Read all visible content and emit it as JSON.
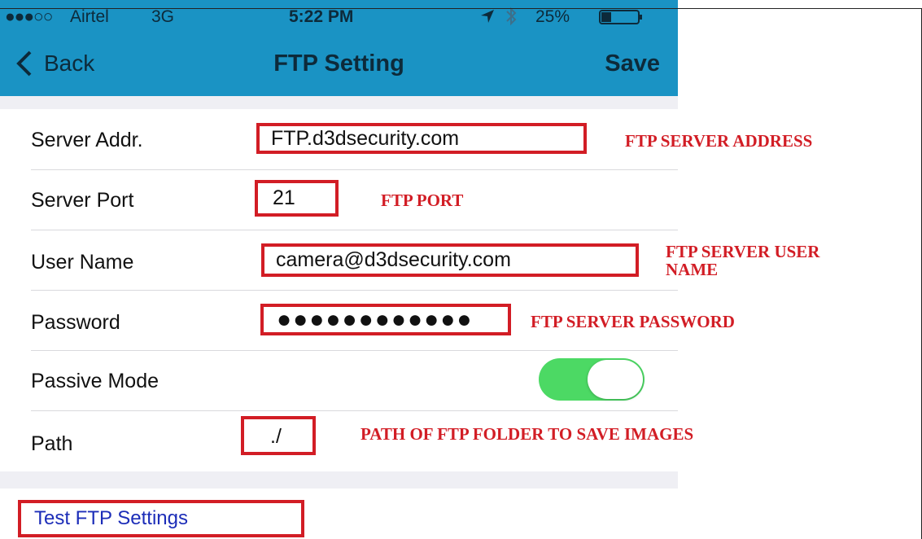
{
  "status_bar": {
    "signal": "●●●○○",
    "carrier": "Airtel",
    "network": "3G",
    "time": "5:22 PM",
    "battery": "25%"
  },
  "nav": {
    "back_label": "Back",
    "title": "FTP Setting",
    "save_label": "Save"
  },
  "form": {
    "server_addr": {
      "label": "Server Addr.",
      "value": "FTP.d3dsecurity.com"
    },
    "server_port": {
      "label": "Server Port",
      "value": "21"
    },
    "user_name": {
      "label": "User Name",
      "value": "camera@d3dsecurity.com"
    },
    "password": {
      "label": "Password",
      "value": "●●●●●●●●●●●●"
    },
    "passive_mode": {
      "label": "Passive Mode",
      "on": true
    },
    "path": {
      "label": "Path",
      "value": "./"
    }
  },
  "test_button": {
    "label": "Test FTP Settings"
  },
  "annotations": {
    "server_address": "FTP SERVER ADDRESS",
    "port": "FTP PORT",
    "user_name_line1": "FTP SERVER USER",
    "user_name_line2": "NAME",
    "password": "FTP SERVER PASSWORD",
    "path": "PATH OF FTP FOLDER TO SAVE IMAGES"
  },
  "colors": {
    "nav_bar": "#1a93c4",
    "highlight_box": "#d21d25",
    "toggle_on": "#4cd964",
    "link": "#1c2db8"
  }
}
